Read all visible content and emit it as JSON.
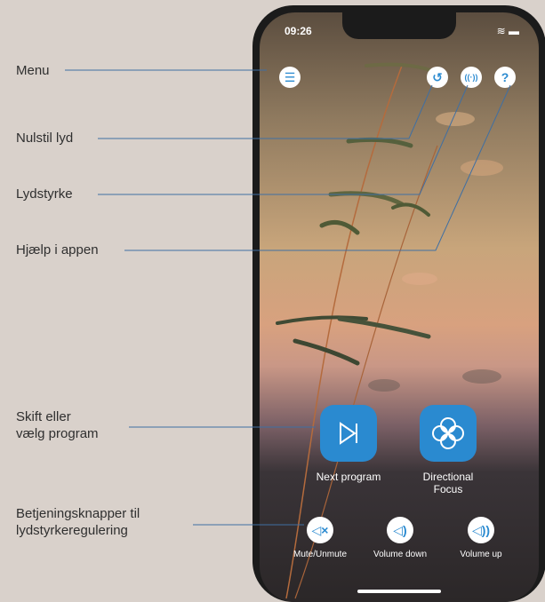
{
  "callouts": {
    "menu": "Menu",
    "reset": "Nulstil lyd",
    "volume": "Lydstyrke",
    "help": "Hjælp i appen",
    "program_l1": "Skift eller",
    "program_l2": "vælg program",
    "controls_l1": "Betjeningsknapper til",
    "controls_l2": "lydstyrkeregulering"
  },
  "phone": {
    "time": "09:26",
    "status_icons": "≋ ▬"
  },
  "top_buttons": {
    "menu_icon": "☰",
    "reset_icon": "↺",
    "volume_icon": "((·))",
    "help_icon": "?"
  },
  "programs": {
    "next_label": "Next program",
    "focus_label_l1": "Directional",
    "focus_label_l2": "Focus"
  },
  "volume_controls": {
    "mute_label": "Mute/Unmute",
    "down_label": "Volume down",
    "up_label": "Volume up"
  },
  "colors": {
    "accent": "#2a8ad0",
    "callout_line": "#3f6fa3"
  }
}
